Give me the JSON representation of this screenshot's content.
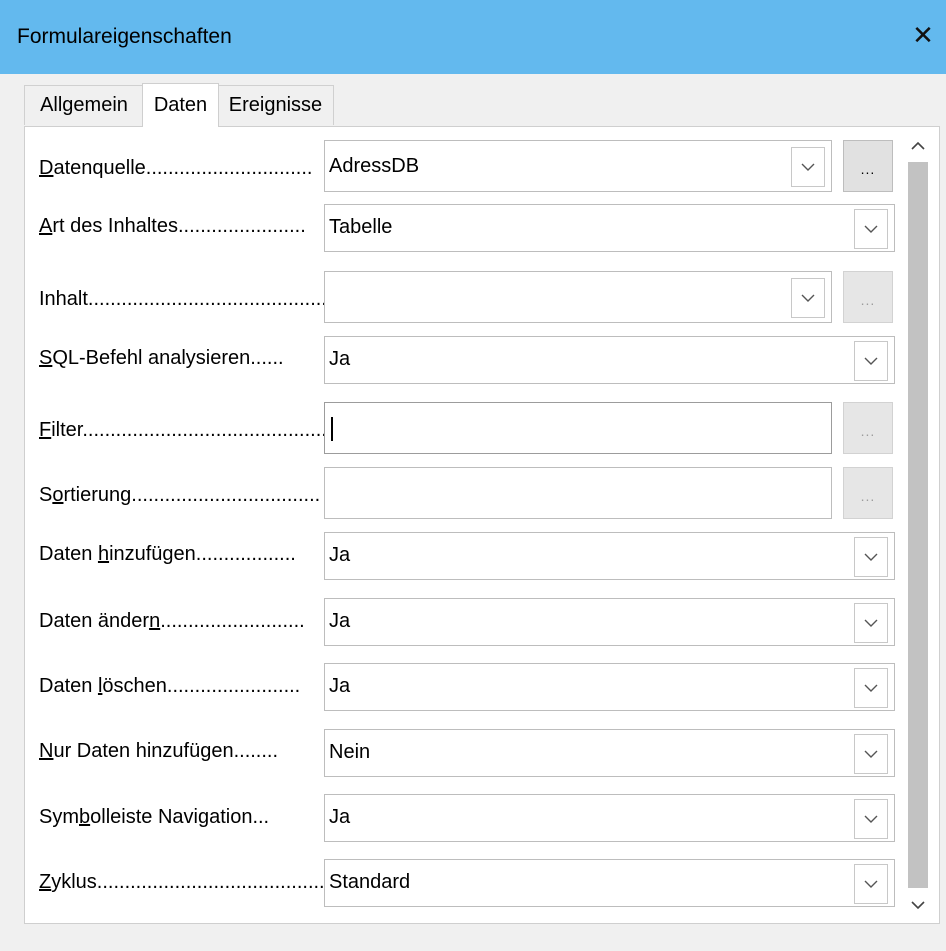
{
  "window": {
    "title": "Formulareigenschaften"
  },
  "tabs": [
    "Allgemein",
    "Daten",
    "Ereignisse"
  ],
  "active_tab": "Daten",
  "ellipsis": "...",
  "fields": [
    {
      "label_pre": "",
      "label_mn": "D",
      "label_post": "atenquelle..............................",
      "value": "AdressDB"
    },
    {
      "label_pre": "",
      "label_mn": "A",
      "label_post": "rt des Inhaltes.......................",
      "value": "Tabelle"
    },
    {
      "label_pre": "Inhalt...........................................",
      "label_mn": "",
      "label_post": "",
      "value": ""
    },
    {
      "label_pre": "",
      "label_mn": "S",
      "label_post": "QL-Befehl analysieren......",
      "value": "Ja"
    },
    {
      "label_pre": "",
      "label_mn": "F",
      "label_post": "ilter..............................................",
      "value": ""
    },
    {
      "label_pre": "S",
      "label_mn": "o",
      "label_post": "rtierung..................................",
      "value": ""
    },
    {
      "label_pre": "Daten ",
      "label_mn": "h",
      "label_post": "inzufügen..................",
      "value": "Ja"
    },
    {
      "label_pre": "Daten änder",
      "label_mn": "n",
      "label_post": "..........................",
      "value": "Ja"
    },
    {
      "label_pre": "Daten ",
      "label_mn": "l",
      "label_post": "öschen........................",
      "value": "Ja"
    },
    {
      "label_pre": "",
      "label_mn": "N",
      "label_post": "ur Daten hinzufügen........",
      "value": "Nein"
    },
    {
      "label_pre": "Sym",
      "label_mn": "b",
      "label_post": "olleiste Navigation...",
      "value": "Ja"
    },
    {
      "label_pre": "",
      "label_mn": "Z",
      "label_post": "yklus..........................................",
      "value": "Standard"
    }
  ]
}
